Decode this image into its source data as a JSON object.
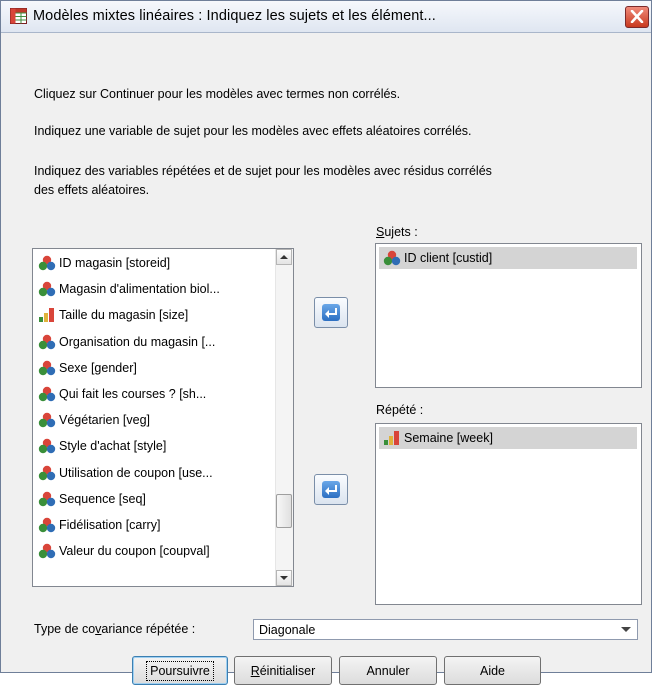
{
  "window": {
    "title": "Modèles mixtes linéaires : Indiquez les sujets et les élément..."
  },
  "instructions": {
    "line1": "Cliquez sur Continuer pour les modèles avec termes non corrélés.",
    "line2": "Indiquez une variable de sujet pour les modèles avec effets aléatoires corrélés.",
    "line3a": "Indiquez des variables répétées et de sujet pour les modèles avec résidus corrélés",
    "line3b": "des effets aléatoires."
  },
  "variables": [
    {
      "label": "ID magasin [storeid]",
      "icon": "nominal-icon"
    },
    {
      "label": "Magasin d'alimentation biol...",
      "icon": "nominal-icon"
    },
    {
      "label": "Taille du magasin [size]",
      "icon": "ordinal-icon"
    },
    {
      "label": "Organisation du magasin [...",
      "icon": "nominal-icon"
    },
    {
      "label": "Sexe [gender]",
      "icon": "nominal-icon"
    },
    {
      "label": "Qui fait les courses ? [sh...",
      "icon": "nominal-icon"
    },
    {
      "label": "Végétarien [veg]",
      "icon": "nominal-icon"
    },
    {
      "label": "Style d'achat [style]",
      "icon": "nominal-icon"
    },
    {
      "label": "Utilisation de coupon [use...",
      "icon": "nominal-icon"
    },
    {
      "label": "Sequence [seq]",
      "icon": "nominal-icon"
    },
    {
      "label": "Fidélisation [carry]",
      "icon": "nominal-icon"
    },
    {
      "label": "Valeur du coupon [coupval]",
      "icon": "nominal-icon"
    }
  ],
  "scroll": {
    "position": 0.85
  },
  "subjects": {
    "label_prefix": "",
    "label_mnemonic": "S",
    "label_rest": "ujets :",
    "items": [
      {
        "label": "ID client [custid]",
        "icon": "nominal-icon"
      }
    ]
  },
  "repeated": {
    "label": "Répété :",
    "items": [
      {
        "label": "Semaine [week]",
        "icon": "ordinal-icon"
      }
    ]
  },
  "covariance": {
    "label_pre": "Type de co",
    "label_mnemonic": "v",
    "label_post": "ariance répétée :",
    "value": "Diagonale"
  },
  "buttons": {
    "continue": "Poursuivre",
    "reset_mnemonic": "R",
    "reset_rest": "éinitialiser",
    "cancel": "Annuler",
    "help": "Aide"
  },
  "colors": {
    "accent": "#2c6fc2",
    "selection": "#d4d4d4",
    "close": "#c8391f"
  }
}
